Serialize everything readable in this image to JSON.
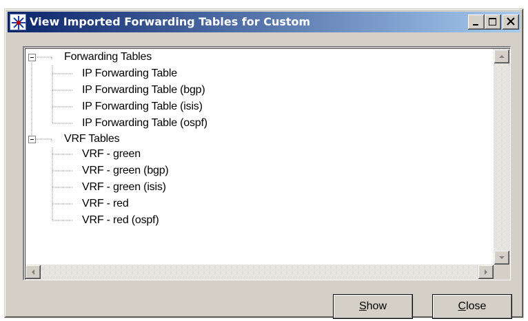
{
  "window": {
    "title": "View Imported Forwarding Tables for Custom",
    "app_icon": "star-icon",
    "controls": {
      "minimize": "minimize-icon",
      "maximize": "maximize-icon",
      "close": "close-icon"
    }
  },
  "tree": {
    "expander_icon": "minus-box-icon",
    "groups": [
      {
        "label": "Forwarding Tables",
        "expanded": true,
        "children": [
          "IP Forwarding Table",
          "IP Forwarding Table (bgp)",
          "IP Forwarding Table (isis)",
          "IP Forwarding Table (ospf)"
        ]
      },
      {
        "label": "VRF Tables",
        "expanded": true,
        "children": [
          "VRF - green",
          "VRF - green (bgp)",
          "VRF - green (isis)",
          "VRF - red",
          "VRF - red (ospf)"
        ]
      }
    ]
  },
  "buttons": {
    "show": {
      "accel": "S",
      "rest": "how"
    },
    "close": {
      "accel": "C",
      "rest": "lose"
    }
  },
  "colors": {
    "titlebar_start": "#0a246a",
    "titlebar_end": "#a6caf0",
    "face": "#d4d0c8"
  }
}
